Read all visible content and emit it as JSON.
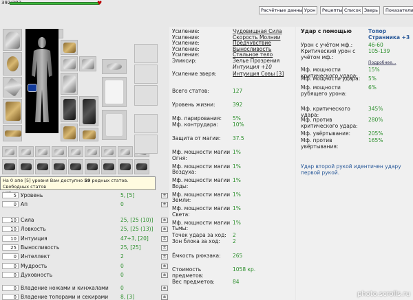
{
  "hp": {
    "text": "392/392",
    "fraction": 1.0
  },
  "tabs": [
    {
      "key": "t1",
      "label": "Расчётные данные"
    },
    {
      "key": "t2",
      "label": "Урон"
    },
    {
      "key": "t3",
      "label": "Рецепты"
    },
    {
      "key": "t4",
      "label": "Список"
    },
    {
      "key": "t5",
      "label": "Зверь"
    },
    {
      "key": "t6",
      "label": "Показатели"
    }
  ],
  "tooltip": {
    "line1a": "На 0 апе [5] уровня Вам доступно ",
    "line1b": "59",
    "line1c": " родных статов. Свободных статов",
    "line2": "нет."
  },
  "stats_top": [
    {
      "box": "5",
      "label": "Уровень",
      "value": "5, [5]"
    },
    {
      "box": "0",
      "label": "Ап",
      "value": "0"
    }
  ],
  "stats_main": [
    {
      "box": "10",
      "label": "Сила",
      "value": "25, [25 (10)]"
    },
    {
      "box": "10",
      "label": "Ловкость",
      "value": "25, [25 (13)]"
    },
    {
      "box": "10",
      "label": "Интуиция",
      "value": "47+3, [20]"
    },
    {
      "box": "25",
      "label": "Выносливость",
      "value": "25, [25]"
    },
    {
      "box": "0",
      "label": "Интеллект",
      "value": "2"
    },
    {
      "box": "0",
      "label": "Мудрость",
      "value": "0"
    },
    {
      "box": "0",
      "label": "Духовность",
      "value": "0"
    }
  ],
  "stats_skills": [
    {
      "box": "0",
      "label": "Владение ножами и кинжалами",
      "value": "0"
    },
    {
      "box": "0",
      "label": "Владение топорами и секирами",
      "value": "8, [3]"
    }
  ],
  "boosts": [
    {
      "label": "Усиление:",
      "value": "Чудовищная Сила"
    },
    {
      "label": "Усиление:",
      "value": "Скорость Молнии"
    },
    {
      "label": "Усиление:",
      "value": "Предчувствие"
    },
    {
      "label": "Усиление:",
      "value": "Выносливость"
    },
    {
      "label": "Усиление:",
      "value": "Стальное тело"
    }
  ],
  "elixir": {
    "label": "Эликсир:",
    "value": "Зелье Прозрения",
    "sub": "Интуиция +10"
  },
  "beast": {
    "label": "Усиление зверя:",
    "value": "Интуиция Совы [3]"
  },
  "col2": {
    "total_label": "Всего статов:",
    "total": "127",
    "life_label": "Уровень жизни:",
    "life": "392",
    "parry_label": "Мф. парирования:",
    "parry": "5%",
    "counter_label": "Мф. контрудара:",
    "counter": "10%",
    "magic_def_label": "Защита от магии:",
    "magic_def": "37.5",
    "magic": [
      {
        "l1": "Мф. мощности магии",
        "l2": "Огня:",
        "v": "1%"
      },
      {
        "l1": "Мф. мощности магии",
        "l2": "Воздуха:",
        "v": "1%"
      },
      {
        "l1": "Мф. мощности магии",
        "l2": "Воды:",
        "v": "1%"
      },
      {
        "l1": "Мф. мощности магии",
        "l2": "Земли:",
        "v": "1%"
      },
      {
        "l1": "Мф. мощности магии",
        "l2": "Света:",
        "v": "1%"
      },
      {
        "l1": "Мф. мощности магии",
        "l2": "Тьмы:",
        "v": "1%"
      }
    ],
    "hit_points_label": "Точек удара за ход:",
    "hit_points": "2",
    "block_label": "Зон блока за ход:",
    "block": "2",
    "backpack_label": "Ёмкость рюкзака:",
    "backpack": "265",
    "cost_l1": "Стоимость",
    "cost_l2": "предметов:",
    "cost": "1058 кр.",
    "weight_label": "Вес предметов:",
    "weight": "84"
  },
  "col3": {
    "heading": "Удар с помощью",
    "weapon_l1": "Топор",
    "weapon_l2": "Странника +3",
    "dmg_label": "Урон с учётом мф.:",
    "dmg": "46-60",
    "crit_dmg_l1": "Критический урон с",
    "crit_dmg_l2": "учётом мф.:",
    "crit_dmg": "105-139",
    "more": "Подробнее...",
    "rows": [
      {
        "l1": "Мф. мощности",
        "l2": "критического удара:",
        "v": "15%"
      },
      {
        "l1": "Мф. мощности удара:",
        "l2": "",
        "v": "5%"
      },
      {
        "l1": "Мф. мощности",
        "l2": "рубящего урона:",
        "v": "6%"
      }
    ],
    "rows2": [
      {
        "l1": "Мф. критического",
        "l2": "удара:",
        "v": "345%"
      },
      {
        "l1": "Мф. против",
        "l2": "критического удара:",
        "v": "280%"
      },
      {
        "l1": "Мф. увёртывания:",
        "l2": "",
        "v": "205%"
      },
      {
        "l1": "Мф. против",
        "l2": "увёртывания:",
        "v": "165%"
      }
    ],
    "note_l1": "Удар второй рукой идентичен удару",
    "note_l2": "первой рукой."
  },
  "watermark": "photo.scrolls.ru"
}
